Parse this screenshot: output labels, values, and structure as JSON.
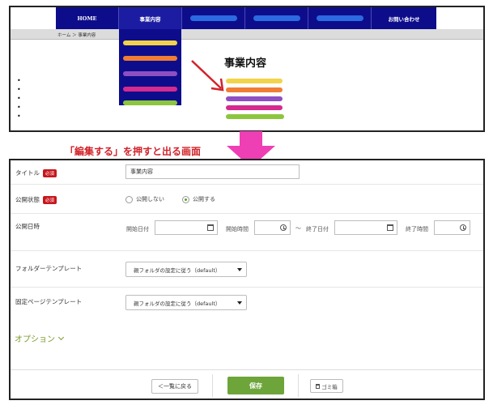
{
  "preview": {
    "nav": {
      "home": "HOME",
      "business": "事業内容",
      "contact": "お問い合わせ"
    },
    "breadcrumb": "ホーム ＞ 事業内容",
    "title": "事業内容",
    "dropdown_colors": [
      "#f2d44a",
      "#f07d34",
      "#8e4fc2",
      "#d52a8e",
      "#8cc63e"
    ],
    "content_colors": [
      "#f2d44a",
      "#f07d34",
      "#8e4fc2",
      "#d52a8e",
      "#8cc63e"
    ],
    "nav_pill_color": "#2b6ae0",
    "nav_bg": "#0d0d8c"
  },
  "caption": "「編集する」を押すと出る画面",
  "form": {
    "title_label": "タイトル",
    "required_badge": "必須",
    "title_value": "事業内容",
    "status_label": "公開状態",
    "status_options": [
      "公開しない",
      "公開する"
    ],
    "status_selected": "公開する",
    "datetime_label": "公開日時",
    "start_date": "開始日付",
    "start_time": "開始時間",
    "tilde": "〜",
    "end_date": "終了日付",
    "end_time": "終了時間",
    "folder_template_label": "フォルダーテンプレート",
    "folder_template_value": "親フォルダの設定に従う（default）",
    "page_template_label": "固定ページテンプレート",
    "page_template_value": "親フォルダの設定に従う（default）",
    "options_label": "オプション",
    "back_button": "＜一覧に戻る",
    "save_button": "保存",
    "trash_button": "ゴミ箱",
    "accent": "#6da53a",
    "required_color": "#c7161d"
  }
}
